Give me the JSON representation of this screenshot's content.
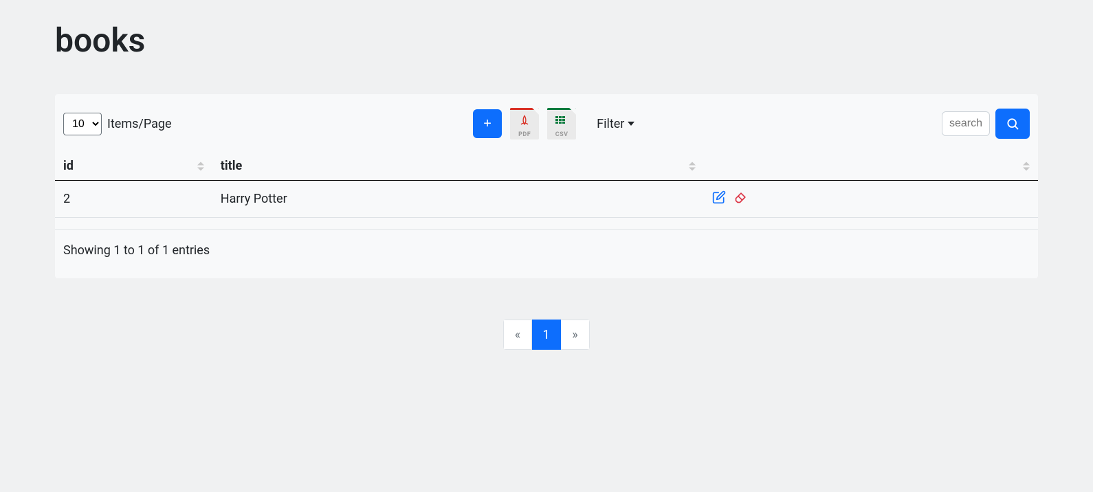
{
  "page": {
    "title": "books"
  },
  "toolbar": {
    "items_per_page_value": "10",
    "items_per_page_label": "Items/Page",
    "add_label": "+",
    "pdf_label": "PDF",
    "csv_label": "CSV",
    "filter_label": "Filter",
    "search_placeholder": "search"
  },
  "table": {
    "columns": {
      "id": "id",
      "title": "title"
    },
    "rows": [
      {
        "id": "2",
        "title": "Harry Potter"
      }
    ]
  },
  "info": {
    "text": "Showing 1 to 1 of 1 entries"
  },
  "pagination": {
    "prev": "«",
    "next": "»",
    "current": "1"
  }
}
